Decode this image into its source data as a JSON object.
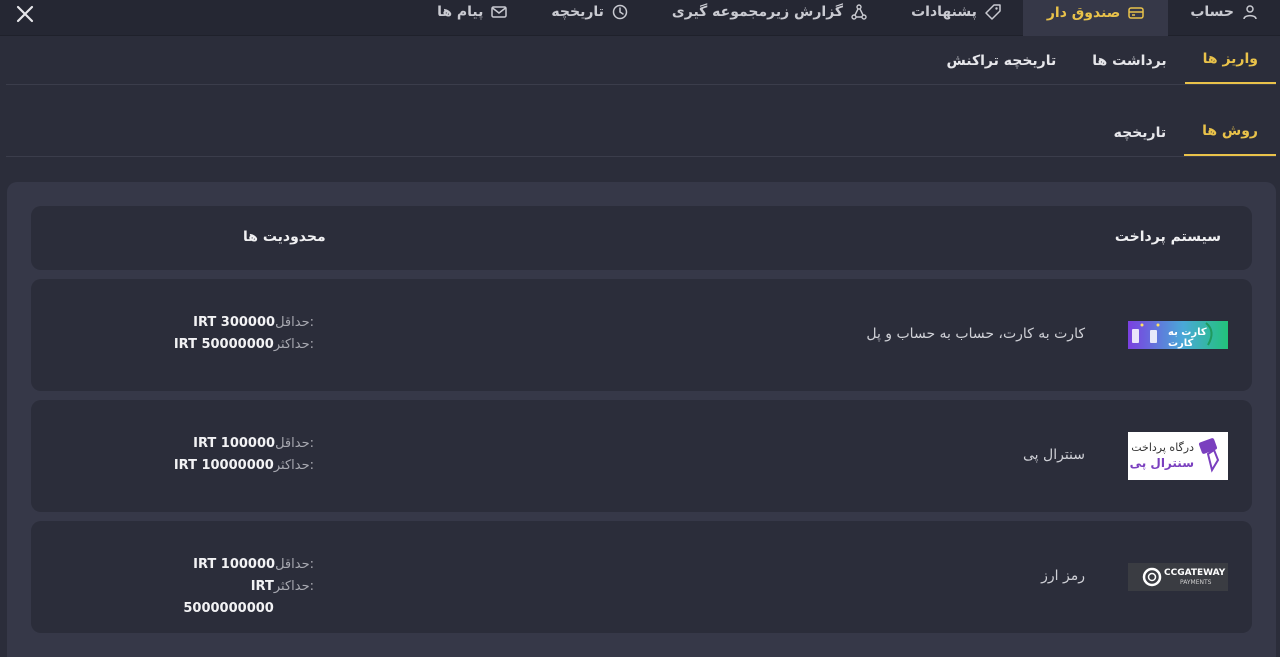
{
  "topnav": {
    "tabs": [
      {
        "label": "حساب",
        "icon": "user-icon"
      },
      {
        "label": "صندوق دار",
        "icon": "wallet-icon",
        "active": true
      },
      {
        "label": "پشنهادات",
        "icon": "tag-icon"
      },
      {
        "label": "گزارش زیرمجموعه گیری",
        "icon": "network-icon"
      },
      {
        "label": "تاریخچه",
        "icon": "clock-icon"
      },
      {
        "label": "پیام ها",
        "icon": "mail-icon"
      }
    ],
    "close_icon": "close-icon"
  },
  "subtabs": {
    "deposits": "واریز ها",
    "withdrawals": "برداشت ها",
    "transactions": "تاریخچه تراکنش"
  },
  "subtabs2": {
    "methods": "روش ها",
    "history": "تاریخچه"
  },
  "table": {
    "col_system": "سیستم پرداخت",
    "col_limits": "محدودیت ها"
  },
  "methods": [
    {
      "name": "کارت به کارت، حساب به حساب و پل",
      "logo_text": "کارت به کارت",
      "min_label": "حداقل:",
      "min_value": "IRT 300000",
      "max_label": "حداکثر:",
      "max_value": "IRT 50000000"
    },
    {
      "name": "سنترال پی",
      "logo_text_top": "درگاه پرداخت",
      "logo_text_bottom": "سنترال پی",
      "min_label": "حداقل:",
      "min_value": "IRT 100000",
      "max_label": "حداکثر:",
      "max_value": "IRT 10000000"
    },
    {
      "name": "رمز ارز",
      "logo_text_top": "CCGATEWAY",
      "logo_text_bottom": "PAYMENTS",
      "min_label": "حداقل:",
      "min_value": "IRT 100000",
      "max_label": "حداکثر:",
      "max_value": "IRT 5000000000"
    }
  ],
  "colors": {
    "accent": "#e9c24a",
    "background": "#2b2d3a",
    "panel": "#363848"
  }
}
